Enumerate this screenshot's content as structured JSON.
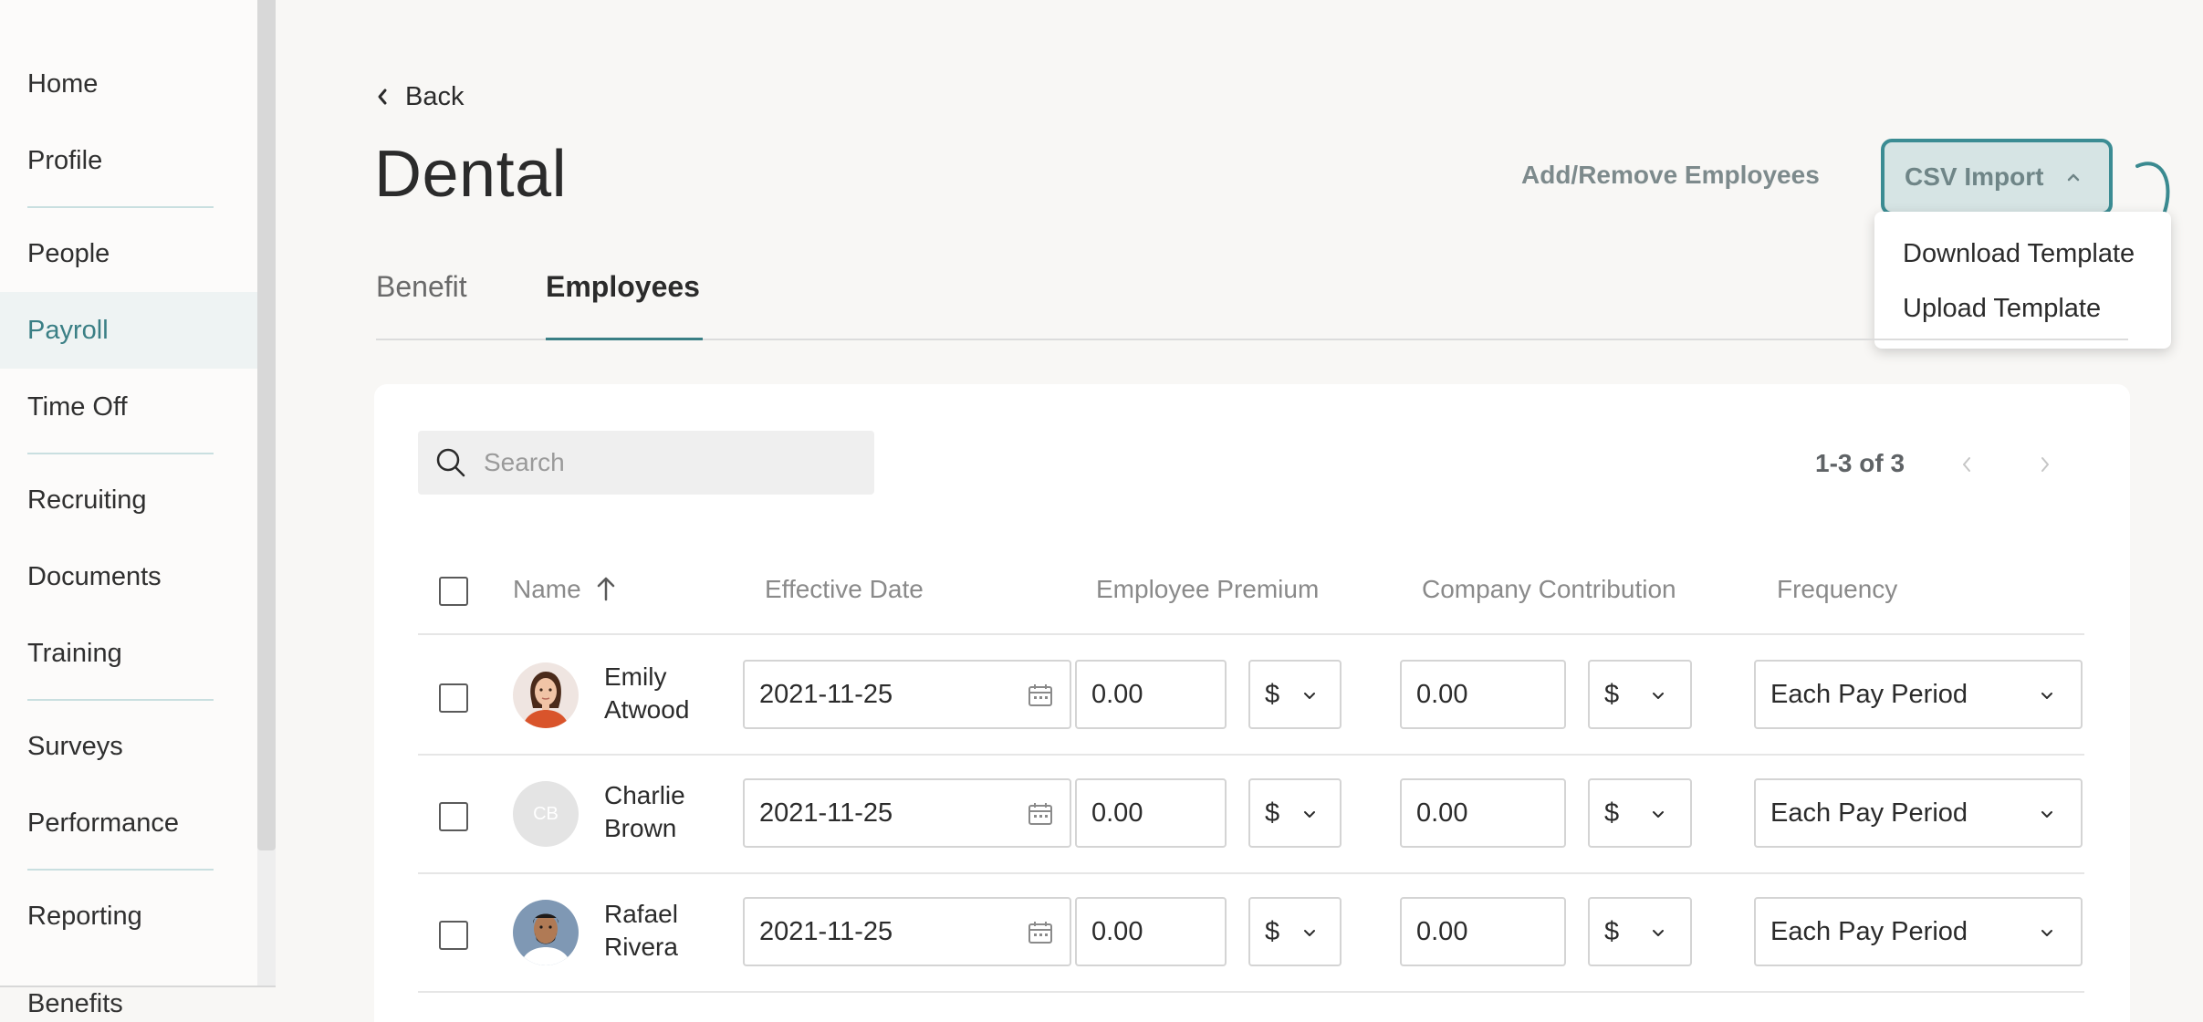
{
  "sidebar": {
    "items": [
      {
        "label": "Home"
      },
      {
        "label": "Profile"
      },
      {
        "label": "People"
      },
      {
        "label": "Payroll"
      },
      {
        "label": "Time Off"
      },
      {
        "label": "Recruiting"
      },
      {
        "label": "Documents"
      },
      {
        "label": "Training"
      },
      {
        "label": "Surveys"
      },
      {
        "label": "Performance"
      },
      {
        "label": "Reporting"
      }
    ],
    "active": "Payroll",
    "cutoff_label": "Benefits"
  },
  "header": {
    "back_label": "Back",
    "title": "Dental",
    "add_remove_label": "Add/Remove Employees",
    "csv_import_label": "CSV Import"
  },
  "csv_menu": {
    "items": [
      {
        "label": "Download Template"
      },
      {
        "label": "Upload Template"
      }
    ]
  },
  "tabs": [
    {
      "label": "Benefit"
    },
    {
      "label": "Employees",
      "active": true
    }
  ],
  "search": {
    "placeholder": "Search",
    "value": ""
  },
  "pagination": {
    "text": "1-3 of 3"
  },
  "table": {
    "headers": {
      "name": "Name",
      "effective_date": "Effective Date",
      "employee_premium": "Employee Premium",
      "company_contribution": "Company Contribution",
      "frequency": "Frequency"
    },
    "rows": [
      {
        "name": "Emily Atwood",
        "first": "Emily",
        "last": "Atwood",
        "initials": "",
        "effective_date": "2021-11-25",
        "employee_premium": "0.00",
        "premium_unit": "$",
        "company_contribution": "0.00",
        "contribution_unit": "$",
        "frequency": "Each Pay Period"
      },
      {
        "name": "Charlie Brown",
        "first": "Charlie",
        "last": "Brown",
        "initials": "CB",
        "effective_date": "2021-11-25",
        "employee_premium": "0.00",
        "premium_unit": "$",
        "company_contribution": "0.00",
        "contribution_unit": "$",
        "frequency": "Each Pay Period"
      },
      {
        "name": "Rafael Rivera",
        "first": "Rafael",
        "last": "Rivera",
        "initials": "",
        "effective_date": "2021-11-25",
        "employee_premium": "0.00",
        "premium_unit": "$",
        "company_contribution": "0.00",
        "contribution_unit": "$",
        "frequency": "Each Pay Period"
      }
    ]
  },
  "colors": {
    "accent": "#3a7f85",
    "csv_border": "#3b8c93",
    "csv_bg": "#d6e4e4",
    "active_nav_bg": "#eef3f3"
  }
}
